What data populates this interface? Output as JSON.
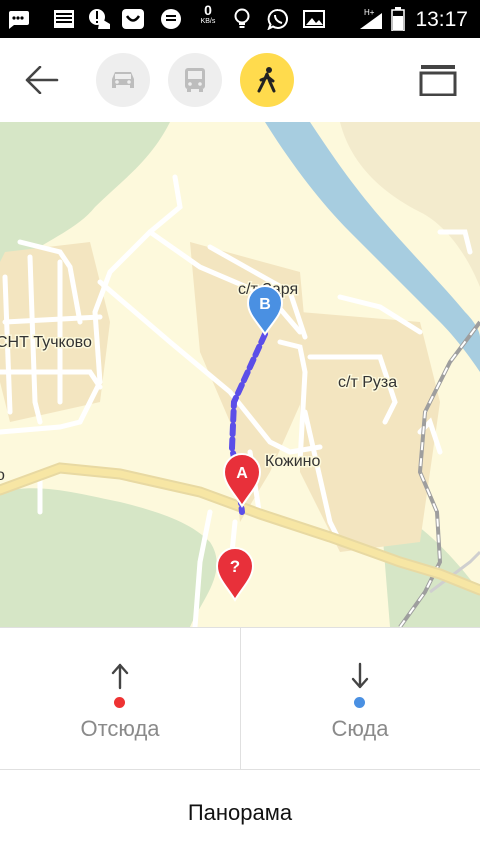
{
  "status_bar": {
    "time": "13:17",
    "speed_value": "0",
    "speed_unit": "KB/s",
    "network": "H+",
    "icons": [
      "messaging-icon",
      "keyboard-icon",
      "notification-icon",
      "smile-app-icon",
      "chat-icon",
      "speed-indicator",
      "bulb-icon",
      "viber-icon",
      "image-icon",
      "signal-icon",
      "battery-icon"
    ]
  },
  "toolbar": {
    "back_icon": "arrow-left-icon",
    "modes": [
      {
        "name": "car",
        "icon": "car-icon",
        "active": false
      },
      {
        "name": "bus",
        "icon": "bus-icon",
        "active": false
      },
      {
        "name": "walk",
        "icon": "pedestrian-icon",
        "active": true
      }
    ],
    "layers_icon": "layers-icon",
    "accent_color": "#ffdb4d"
  },
  "map": {
    "labels": {
      "snt_tuchkovo": "СНТ Тучково",
      "st_zarya": "с/т Заря",
      "st_ruza": "с/т Руза",
      "kozhino": "Кожино",
      "left_edge": "о"
    },
    "markers": [
      {
        "letter": "B",
        "color": "#4a90e2",
        "icon": "map-pin-b"
      },
      {
        "letter": "A",
        "color": "#e8303a",
        "icon": "map-pin-a"
      },
      {
        "letter": "?",
        "color": "#e8303a",
        "icon": "map-pin-unknown"
      }
    ],
    "route_color": "#5b4ee8"
  },
  "panel": {
    "from": {
      "label": "Отсюда",
      "dot_color": "#ee3333",
      "icon": "arrow-up-icon"
    },
    "to": {
      "label": "Сюда",
      "dot_color": "#4a90e2",
      "icon": "arrow-down-icon"
    },
    "panorama_label": "Панорама"
  }
}
